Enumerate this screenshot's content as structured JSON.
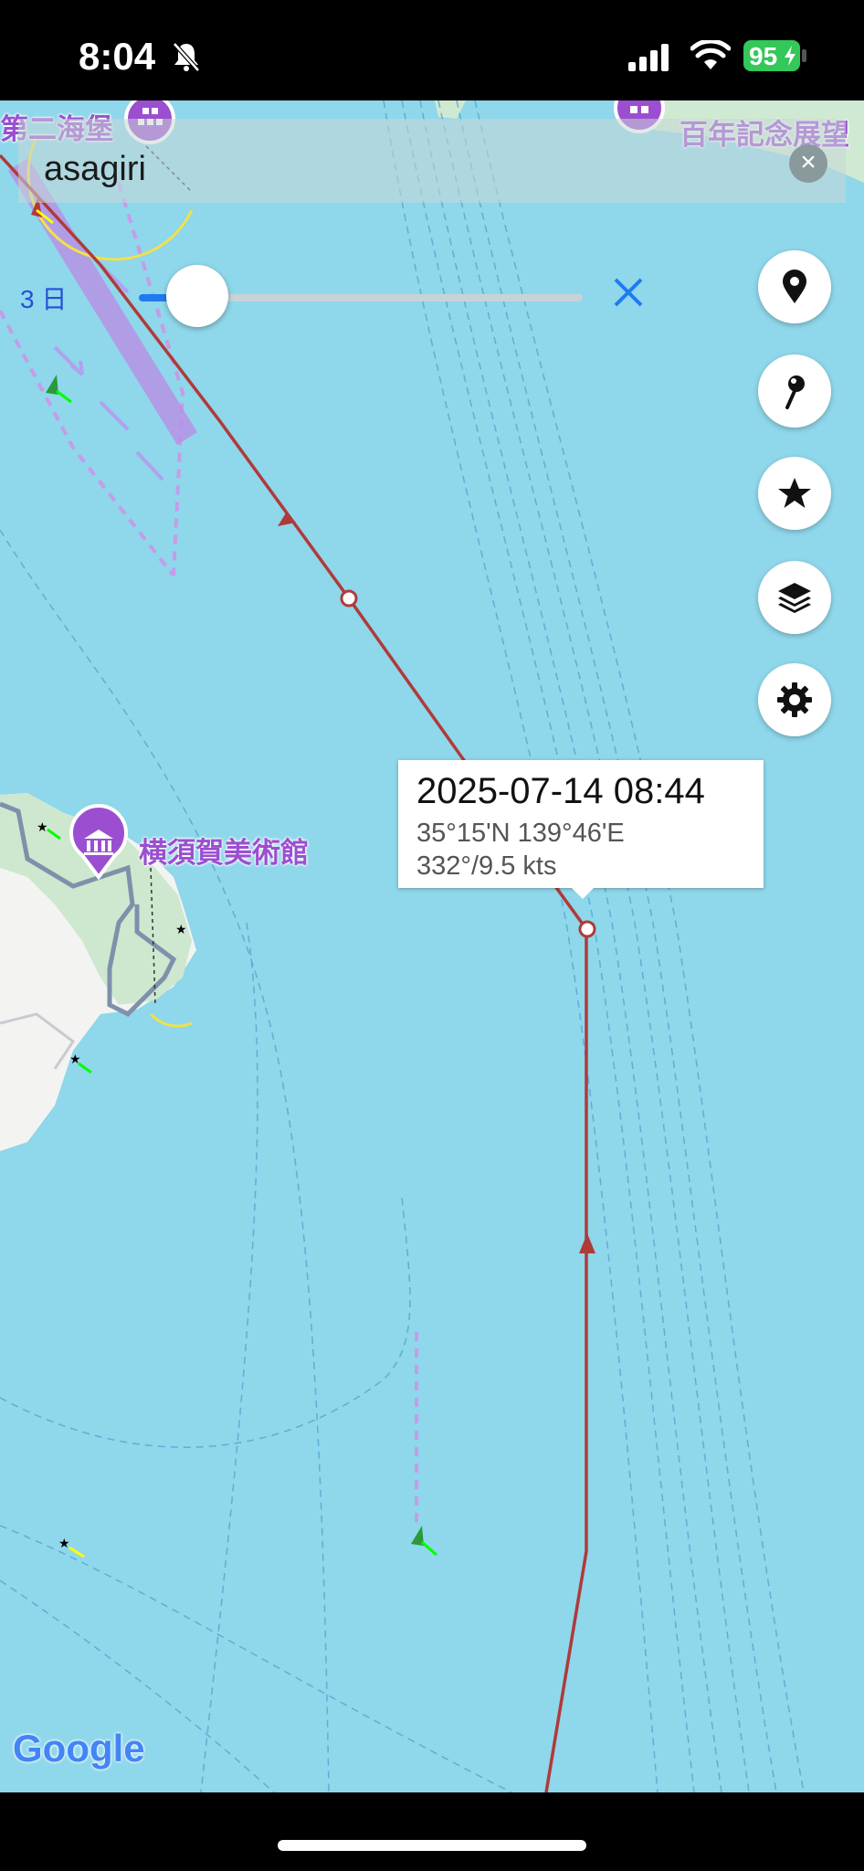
{
  "status_bar": {
    "time": "8:04",
    "battery": "95"
  },
  "search": {
    "query": "asagiri"
  },
  "slider": {
    "label": "3 日",
    "value_fraction": 0.1
  },
  "map": {
    "pois": [
      {
        "label": "第二海堡"
      },
      {
        "label": "百年記念展望"
      },
      {
        "label": "横須賀美術館"
      }
    ],
    "callout": {
      "timestamp": "2025-07-14 08:44",
      "position": "35°15'N 139°46'E",
      "course_speed": "332°/9.5 kts"
    },
    "attribution": "Google"
  },
  "fabs": [
    {
      "icon": "location-pin-icon"
    },
    {
      "icon": "map-pin-icon"
    },
    {
      "icon": "star-icon"
    },
    {
      "icon": "layers-icon"
    },
    {
      "icon": "gear-icon"
    }
  ],
  "colors": {
    "sea": "#8fd7ea",
    "track": "#b03a3a",
    "poi": "#9b4fd0",
    "accent": "#1e7bf0"
  }
}
